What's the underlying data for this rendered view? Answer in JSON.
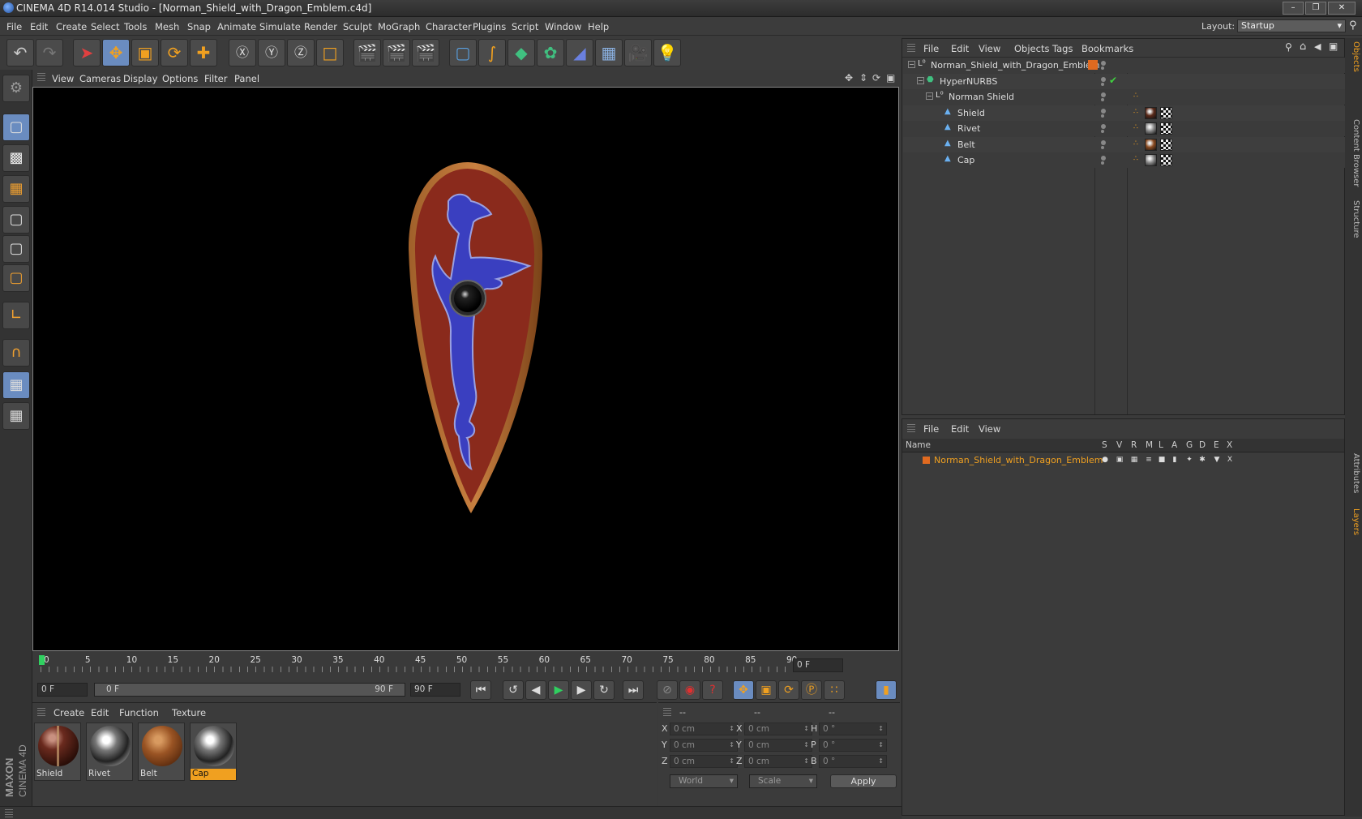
{
  "window": {
    "title": "CINEMA 4D R14.014 Studio - [Norman_Shield_with_Dragon_Emblem.c4d]"
  },
  "menu": [
    "File",
    "Edit",
    "Create",
    "Select",
    "Tools",
    "Mesh",
    "Snap",
    "Animate",
    "Simulate",
    "Render",
    "Sculpt",
    "MoGraph",
    "Character",
    "Plugins",
    "Script",
    "Window",
    "Help"
  ],
  "layout": {
    "label": "Layout:",
    "value": "Startup"
  },
  "viewport_menu": [
    "View",
    "Cameras",
    "Display",
    "Options",
    "Filter",
    "Panel"
  ],
  "timeline": {
    "ticks": [
      "0",
      "5",
      "10",
      "15",
      "20",
      "25",
      "30",
      "35",
      "40",
      "45",
      "50",
      "55",
      "60",
      "65",
      "70",
      "75",
      "80",
      "85",
      "90"
    ],
    "current_frame": "0 F",
    "start": "0 F",
    "range_start": "0 F",
    "range_end": "90 F",
    "end": "90 F"
  },
  "material_menu": [
    "Create",
    "Edit",
    "Function",
    "Texture"
  ],
  "materials": [
    {
      "name": "Shield",
      "style": "shield"
    },
    {
      "name": "Rivet",
      "style": "chrome"
    },
    {
      "name": "Belt",
      "style": "leather"
    },
    {
      "name": "Cap",
      "style": "chrome",
      "selected": true
    }
  ],
  "coords": {
    "headers": [
      "--",
      "--",
      "--"
    ],
    "rows": [
      {
        "a": "X",
        "av": "0 cm",
        "b": "X",
        "bv": "0 cm",
        "c": "H",
        "cv": "0 °"
      },
      {
        "a": "Y",
        "av": "0 cm",
        "b": "Y",
        "bv": "0 cm",
        "c": "P",
        "cv": "0 °"
      },
      {
        "a": "Z",
        "av": "0 cm",
        "b": "Z",
        "bv": "0 cm",
        "c": "B",
        "cv": "0 °"
      }
    ],
    "mode": "World",
    "transform": "Scale",
    "apply": "Apply"
  },
  "object_menu": [
    "File",
    "Edit",
    "View",
    "Objects",
    "Tags",
    "Bookmarks"
  ],
  "objects": [
    {
      "name": "Norman_Shield_with_Dragon_Emblem",
      "indent": 0,
      "icon": "null-icon"
    },
    {
      "name": "HyperNURBS",
      "indent": 1,
      "icon": "hypernurbs-icon"
    },
    {
      "name": "Norman Shield",
      "indent": 2,
      "icon": "null-icon"
    },
    {
      "name": "Shield",
      "indent": 3,
      "icon": "polygon-icon",
      "mat": "#5a2a1a"
    },
    {
      "name": "Rivet",
      "indent": 3,
      "icon": "polygon-icon",
      "mat": "#888888"
    },
    {
      "name": "Belt",
      "indent": 3,
      "icon": "polygon-icon",
      "mat": "#8a4a20"
    },
    {
      "name": "Cap",
      "indent": 3,
      "icon": "polygon-icon",
      "mat": "#888888"
    }
  ],
  "layer_menu": [
    "File",
    "Edit",
    "View"
  ],
  "layer_headers": [
    "Name",
    "S",
    "V",
    "R",
    "M",
    "L",
    "A",
    "G",
    "D",
    "E",
    "X"
  ],
  "layers": [
    {
      "name": "Norman_Shield_with_Dragon_Emblem",
      "color": "#e06a20"
    }
  ],
  "right_tabs": [
    "Objects",
    "Content Browser",
    "Structure",
    "Attributes",
    "Layers"
  ],
  "brand": {
    "line1": "MAXON",
    "line2": "CINEMA 4D"
  }
}
